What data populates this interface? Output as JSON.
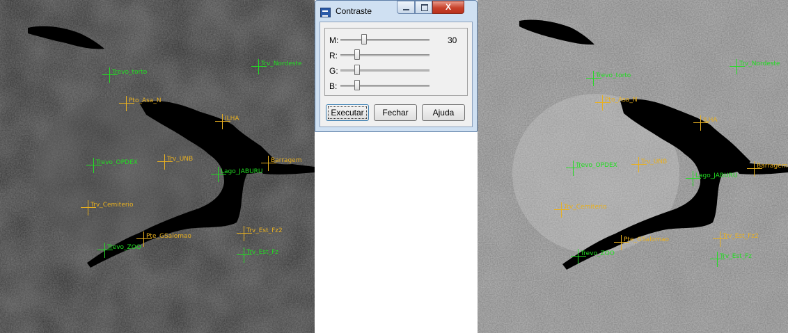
{
  "dialog": {
    "title": "Contraste",
    "close_glyph": "X",
    "sliders": [
      {
        "label": "M:",
        "value": 30,
        "value_text": "30"
      },
      {
        "label": "R:",
        "value": 0
      },
      {
        "label": "G:",
        "value": 0
      },
      {
        "label": "B:",
        "value": 0
      }
    ],
    "buttons": {
      "executar": "Executar",
      "fechar": "Fechar",
      "ajuda": "Ajuda"
    }
  },
  "colors": {
    "marker_green": "#22dd22",
    "marker_orange": "#e8b020",
    "water": "#000000"
  },
  "left_image": {
    "markers": [
      {
        "label": "Trevo_torto",
        "color": "green"
      },
      {
        "label": "Trv_Nordeste",
        "color": "green"
      },
      {
        "label": "Pto_Asa_N",
        "color": "orange"
      },
      {
        "label": "ILHA",
        "color": "orange"
      },
      {
        "label": "Trevo_OPDEX",
        "color": "green"
      },
      {
        "label": "Trv_UNB",
        "color": "orange"
      },
      {
        "label": "Barragem",
        "color": "orange"
      },
      {
        "label": "Lago_JABURU",
        "color": "green"
      },
      {
        "label": "Trv_Cemiterio",
        "color": "orange"
      },
      {
        "label": "Pte_GSalomao",
        "color": "orange"
      },
      {
        "label": "Trv_Est_Fz2",
        "color": "orange"
      },
      {
        "label": "Trevo_ZOO",
        "color": "green"
      },
      {
        "label": "Trv_Est_Fz",
        "color": "green"
      }
    ]
  },
  "right_image": {
    "markers": [
      {
        "label": "Trevo_torto",
        "color": "green"
      },
      {
        "label": "Trv_Nordeste",
        "color": "green"
      },
      {
        "label": "Pto_Asa_N",
        "color": "orange"
      },
      {
        "label": "ILHA",
        "color": "orange"
      },
      {
        "label": "Trevo_OPDEX",
        "color": "green"
      },
      {
        "label": "Trv_UNB",
        "color": "orange"
      },
      {
        "label": "Barragem",
        "color": "orange"
      },
      {
        "label": "Lago_JABURU",
        "color": "green"
      },
      {
        "label": "Trv_Cemiterio",
        "color": "orange"
      },
      {
        "label": "Pte_GSalomao",
        "color": "orange"
      },
      {
        "label": "Trv_Est_Fz2",
        "color": "orange"
      },
      {
        "label": "Trevo_ZOO",
        "color": "green"
      },
      {
        "label": "Trv_Est_Fz",
        "color": "green"
      }
    ]
  }
}
